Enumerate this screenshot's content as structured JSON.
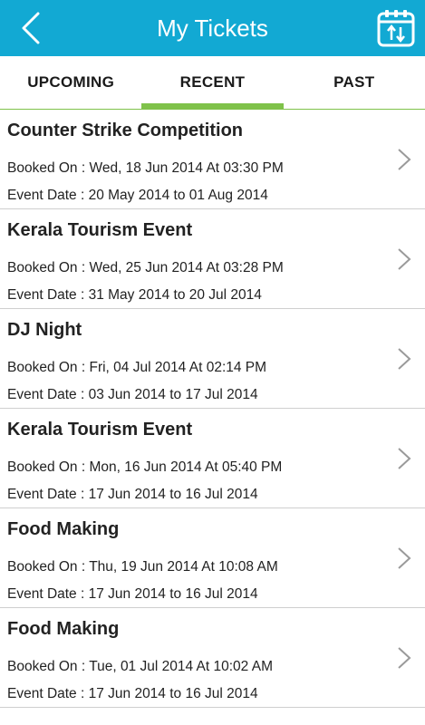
{
  "header": {
    "title": "My Tickets",
    "back_icon": "chevron-left-icon",
    "calendar_icon": "calendar-sort-icon"
  },
  "tabs": [
    {
      "label": "UPCOMING",
      "active": false
    },
    {
      "label": "RECENT",
      "active": true
    },
    {
      "label": "PAST",
      "active": false
    }
  ],
  "tickets": [
    {
      "name": "Counter Strike Competition",
      "booked": "Booked On : Wed, 18 Jun 2014 At 03:30 PM",
      "event": "Event Date : 20 May 2014 to 01 Aug 2014"
    },
    {
      "name": "Kerala Tourism Event",
      "booked": "Booked On : Wed, 25 Jun 2014 At 03:28 PM",
      "event": "Event Date : 31 May 2014 to 20 Jul 2014"
    },
    {
      "name": "DJ Night",
      "booked": "Booked On : Fri, 04 Jul 2014 At 02:14 PM",
      "event": "Event Date : 03 Jun 2014 to 17 Jul 2014"
    },
    {
      "name": "Kerala Tourism Event",
      "booked": "Booked On : Mon, 16 Jun 2014 At 05:40 PM",
      "event": "Event Date : 17 Jun 2014 to 16 Jul 2014"
    },
    {
      "name": "Food Making",
      "booked": "Booked On : Thu, 19 Jun 2014 At 10:08 AM",
      "event": "Event Date : 17 Jun 2014 to 16 Jul 2014"
    },
    {
      "name": "Food Making",
      "booked": "Booked On : Tue, 01 Jul 2014 At 10:02 AM",
      "event": "Event Date : 17 Jun 2014 to 16 Jul 2014"
    }
  ],
  "colors": {
    "header_bg": "#12a9d3",
    "tab_accent": "#7fc24a",
    "divider": "#cfcfcf",
    "chevron": "#9a9a9a"
  }
}
